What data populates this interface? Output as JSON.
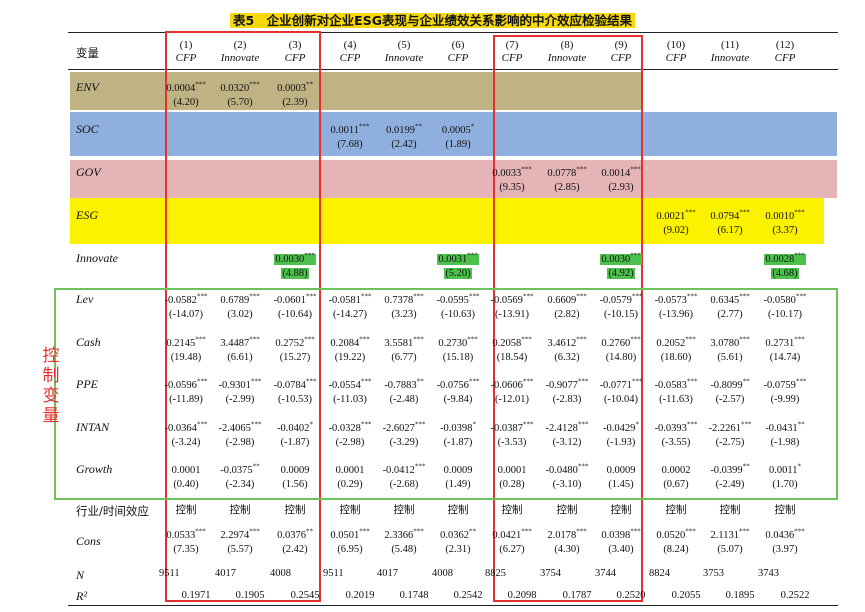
{
  "title": "表5　企业创新对企业ESG表现与企业绩效关系影响的中介效应检验结果",
  "header": {
    "var_label": "变量",
    "columns": [
      {
        "num": "(1)",
        "name": "CFP"
      },
      {
        "num": "(2)",
        "name": "Innovate"
      },
      {
        "num": "(3)",
        "name": "CFP"
      },
      {
        "num": "(4)",
        "name": "CFP"
      },
      {
        "num": "(5)",
        "name": "Innovate"
      },
      {
        "num": "(6)",
        "name": "CFP"
      },
      {
        "num": "(7)",
        "name": "CFP"
      },
      {
        "num": "(8)",
        "name": "Innovate"
      },
      {
        "num": "(9)",
        "name": "CFP"
      },
      {
        "num": "(10)",
        "name": "CFP"
      },
      {
        "num": "(11)",
        "name": "Innovate"
      },
      {
        "num": "(12)",
        "name": "CFP"
      }
    ]
  },
  "side_label": "控制变量",
  "rows": [
    {
      "label": "ENV",
      "cells": [
        {
          "col": 0,
          "coef": "0.0004",
          "sig": "***",
          "t": "(4.20)"
        },
        {
          "col": 1,
          "coef": "0.0320",
          "sig": "***",
          "t": "(5.70)"
        },
        {
          "col": 2,
          "coef": "0.0003",
          "sig": "**",
          "t": "(2.39)"
        }
      ]
    },
    {
      "label": "SOC",
      "cells": [
        {
          "col": 3,
          "coef": "0.0011",
          "sig": "***",
          "t": "(7.68)"
        },
        {
          "col": 4,
          "coef": "0.0199",
          "sig": "**",
          "t": "(2.42)"
        },
        {
          "col": 5,
          "coef": "0.0005",
          "sig": "*",
          "t": "(1.89)"
        }
      ]
    },
    {
      "label": "GOV",
      "cells": [
        {
          "col": 6,
          "coef": "0.0033",
          "sig": "***",
          "t": "(9.35)"
        },
        {
          "col": 7,
          "coef": "0.0778",
          "sig": "***",
          "t": "(2.85)"
        },
        {
          "col": 8,
          "coef": "0.0014",
          "sig": "***",
          "t": "(2.93)"
        }
      ]
    },
    {
      "label": "ESG",
      "cells": [
        {
          "col": 9,
          "coef": "0.0021",
          "sig": "***",
          "t": "(9.02)"
        },
        {
          "col": 10,
          "coef": "0.0794",
          "sig": "***",
          "t": "(6.17)"
        },
        {
          "col": 11,
          "coef": "0.0010",
          "sig": "***",
          "t": "(3.37)"
        }
      ]
    },
    {
      "label": "Innovate",
      "cells": [
        {
          "col": 2,
          "coef": "0.0030",
          "sig": "***",
          "t": "(4.88)",
          "hl": true
        },
        {
          "col": 5,
          "coef": "0.0031",
          "sig": "***",
          "t": "(5.20)",
          "hl": true
        },
        {
          "col": 8,
          "coef": "0.0030",
          "sig": "***",
          "t": "(4.92)",
          "hl": true
        },
        {
          "col": 11,
          "coef": "0.0028",
          "sig": "***",
          "t": "(4.68)",
          "hl": true
        }
      ]
    },
    {
      "label": "Lev",
      "cells": [
        {
          "col": 0,
          "coef": "-0.0582",
          "sig": "***",
          "t": "(-14.07)"
        },
        {
          "col": 1,
          "coef": "0.6789",
          "sig": "***",
          "t": "(3.02)"
        },
        {
          "col": 2,
          "coef": "-0.0601",
          "sig": "***",
          "t": "(-10.64)"
        },
        {
          "col": 3,
          "coef": "-0.0581",
          "sig": "***",
          "t": "(-14.27)"
        },
        {
          "col": 4,
          "coef": "0.7378",
          "sig": "***",
          "t": "(3.23)"
        },
        {
          "col": 5,
          "coef": "-0.0595",
          "sig": "***",
          "t": "(-10.63)"
        },
        {
          "col": 6,
          "coef": "-0.0569",
          "sig": "***",
          "t": "(-13.91)"
        },
        {
          "col": 7,
          "coef": "0.6609",
          "sig": "***",
          "t": "(2.82)"
        },
        {
          "col": 8,
          "coef": "-0.0579",
          "sig": "***",
          "t": "(-10.15)"
        },
        {
          "col": 9,
          "coef": "-0.0573",
          "sig": "***",
          "t": "(-13.96)"
        },
        {
          "col": 10,
          "coef": "0.6345",
          "sig": "***",
          "t": "(2.77)"
        },
        {
          "col": 11,
          "coef": "-0.0580",
          "sig": "***",
          "t": "(-10.17)"
        }
      ]
    },
    {
      "label": "Cash",
      "cells": [
        {
          "col": 0,
          "coef": "0.2145",
          "sig": "***",
          "t": "(19.48)"
        },
        {
          "col": 1,
          "coef": "3.4487",
          "sig": "***",
          "t": "(6.61)"
        },
        {
          "col": 2,
          "coef": "0.2752",
          "sig": "***",
          "t": "(15.27)"
        },
        {
          "col": 3,
          "coef": "0.2084",
          "sig": "***",
          "t": "(19.22)"
        },
        {
          "col": 4,
          "coef": "3.5581",
          "sig": "***",
          "t": "(6.77)"
        },
        {
          "col": 5,
          "coef": "0.2730",
          "sig": "***",
          "t": "(15.18)"
        },
        {
          "col": 6,
          "coef": "0.2058",
          "sig": "***",
          "t": "(18.54)"
        },
        {
          "col": 7,
          "coef": "3.4612",
          "sig": "***",
          "t": "(6.32)"
        },
        {
          "col": 8,
          "coef": "0.2760",
          "sig": "***",
          "t": "(14.80)"
        },
        {
          "col": 9,
          "coef": "0.2052",
          "sig": "***",
          "t": "(18.60)"
        },
        {
          "col": 10,
          "coef": "3.0780",
          "sig": "***",
          "t": "(5.61)"
        },
        {
          "col": 11,
          "coef": "0.2731",
          "sig": "***",
          "t": "(14.74)"
        }
      ]
    },
    {
      "label": "PPE",
      "cells": [
        {
          "col": 0,
          "coef": "-0.0596",
          "sig": "***",
          "t": "(-11.89)"
        },
        {
          "col": 1,
          "coef": "-0.9301",
          "sig": "***",
          "t": "(-2.99)"
        },
        {
          "col": 2,
          "coef": "-0.0784",
          "sig": "***",
          "t": "(-10.53)"
        },
        {
          "col": 3,
          "coef": "-0.0554",
          "sig": "***",
          "t": "(-11.03)"
        },
        {
          "col": 4,
          "coef": "-0.7883",
          "sig": "**",
          "t": "(-2.48)"
        },
        {
          "col": 5,
          "coef": "-0.0756",
          "sig": "***",
          "t": "(-9.84)"
        },
        {
          "col": 6,
          "coef": "-0.0606",
          "sig": "***",
          "t": "(-12.01)"
        },
        {
          "col": 7,
          "coef": "-0.9077",
          "sig": "***",
          "t": "(-2.83)"
        },
        {
          "col": 8,
          "coef": "-0.0771",
          "sig": "***",
          "t": "(-10.04)"
        },
        {
          "col": 9,
          "coef": "-0.0583",
          "sig": "***",
          "t": "(-11.63)"
        },
        {
          "col": 10,
          "coef": "-0.8099",
          "sig": "**",
          "t": "(-2.57)"
        },
        {
          "col": 11,
          "coef": "-0.0759",
          "sig": "***",
          "t": "(-9.99)"
        }
      ]
    },
    {
      "label": "INTAN",
      "cells": [
        {
          "col": 0,
          "coef": "-0.0364",
          "sig": "***",
          "t": "(-3.24)"
        },
        {
          "col": 1,
          "coef": "-2.4065",
          "sig": "***",
          "t": "(-2.98)"
        },
        {
          "col": 2,
          "coef": "-0.0402",
          "sig": "*",
          "t": "(-1.87)"
        },
        {
          "col": 3,
          "coef": "-0.0328",
          "sig": "***",
          "t": "(-2.98)"
        },
        {
          "col": 4,
          "coef": "-2.6027",
          "sig": "***",
          "t": "(-3.29)"
        },
        {
          "col": 5,
          "coef": "-0.0398",
          "sig": "*",
          "t": "(-1.87)"
        },
        {
          "col": 6,
          "coef": "-0.0387",
          "sig": "***",
          "t": "(-3.53)"
        },
        {
          "col": 7,
          "coef": "-2.4128",
          "sig": "***",
          "t": "(-3.12)"
        },
        {
          "col": 8,
          "coef": "-0.0429",
          "sig": "*",
          "t": "(-1.93)"
        },
        {
          "col": 9,
          "coef": "-0.0393",
          "sig": "***",
          "t": "(-3.55)"
        },
        {
          "col": 10,
          "coef": "-2.2261",
          "sig": "***",
          "t": "(-2.75)"
        },
        {
          "col": 11,
          "coef": "-0.0431",
          "sig": "**",
          "t": "(-1.98)"
        }
      ]
    },
    {
      "label": "Growth",
      "cells": [
        {
          "col": 0,
          "coef": "0.0001",
          "sig": "",
          "t": "(0.40)"
        },
        {
          "col": 1,
          "coef": "-0.0375",
          "sig": "**",
          "t": "(-2.34)"
        },
        {
          "col": 2,
          "coef": "0.0009",
          "sig": "",
          "t": "(1.56)"
        },
        {
          "col": 3,
          "coef": "0.0001",
          "sig": "",
          "t": "(0.29)"
        },
        {
          "col": 4,
          "coef": "-0.0412",
          "sig": "***",
          "t": "(-2.68)"
        },
        {
          "col": 5,
          "coef": "0.0009",
          "sig": "",
          "t": "(1.49)"
        },
        {
          "col": 6,
          "coef": "0.0001",
          "sig": "",
          "t": "(0.28)"
        },
        {
          "col": 7,
          "coef": "-0.0480",
          "sig": "***",
          "t": "(-3.10)"
        },
        {
          "col": 8,
          "coef": "0.0009",
          "sig": "",
          "t": "(1.45)"
        },
        {
          "col": 9,
          "coef": "0.0002",
          "sig": "",
          "t": "(0.67)"
        },
        {
          "col": 10,
          "coef": "-0.0399",
          "sig": "**",
          "t": "(-2.49)"
        },
        {
          "col": 11,
          "coef": "0.0011",
          "sig": "*",
          "t": "(1.70)"
        }
      ]
    }
  ],
  "fe_row": {
    "label": "行业/时间效应",
    "value": "控制"
  },
  "cons": {
    "label": "Cons",
    "cells": [
      {
        "coef": "0.0533",
        "sig": "***",
        "t": "(7.35)"
      },
      {
        "coef": "2.2974",
        "sig": "***",
        "t": "(5.57)"
      },
      {
        "coef": "0.0376",
        "sig": "**",
        "t": "(2.42)"
      },
      {
        "coef": "0.0501",
        "sig": "***",
        "t": "(6.95)"
      },
      {
        "coef": "2.3366",
        "sig": "***",
        "t": "(5.48)"
      },
      {
        "coef": "0.0362",
        "sig": "**",
        "t": "(2.31)"
      },
      {
        "coef": "0.0421",
        "sig": "***",
        "t": "(6.27)"
      },
      {
        "coef": "2.0178",
        "sig": "***",
        "t": "(4.30)"
      },
      {
        "coef": "0.0398",
        "sig": "***",
        "t": "(3.40)"
      },
      {
        "coef": "0.0520",
        "sig": "***",
        "t": "(8.24)"
      },
      {
        "coef": "2.1131",
        "sig": "***",
        "t": "(5.07)"
      },
      {
        "coef": "0.0436",
        "sig": "***",
        "t": "(3.97)"
      }
    ]
  },
  "n_row": {
    "label": "N",
    "values": [
      "9511",
      "4017",
      "4008",
      "9511",
      "4017",
      "4008",
      "8825",
      "3754",
      "3744",
      "8824",
      "3753",
      "3743"
    ]
  },
  "r2_row": {
    "label": "R²",
    "values": [
      "0.1971",
      "0.1905",
      "0.2545",
      "0.2019",
      "0.1748",
      "0.2542",
      "0.2098",
      "0.1787",
      "0.2520",
      "0.2055",
      "0.1895",
      "0.2522"
    ]
  },
  "band_colors": {
    "ENV": "#bfb283",
    "SOC": "#8fb0de",
    "GOV": "#e4b4b6",
    "ESG": "#fbf200"
  },
  "box_color": "#e53030",
  "control_box_color": "#6fc15a"
}
